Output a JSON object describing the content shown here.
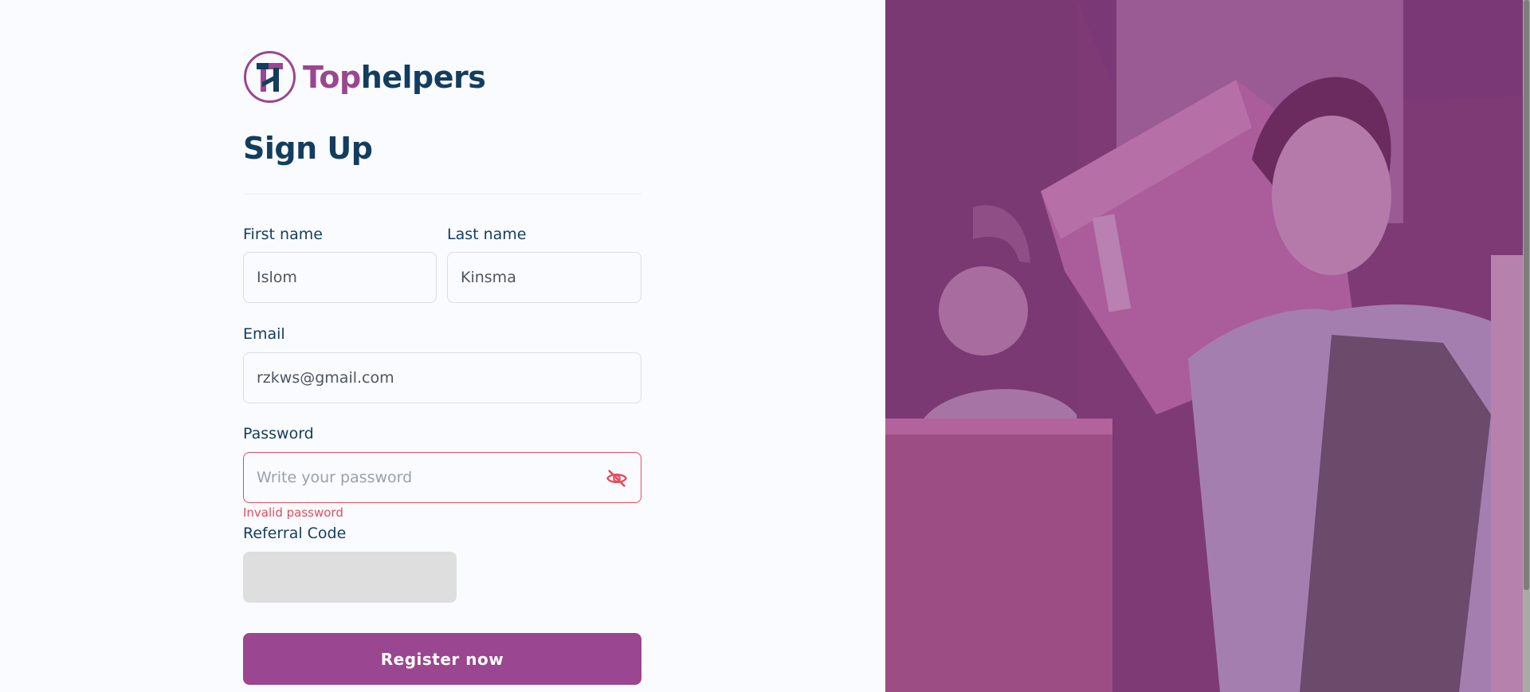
{
  "brand": {
    "name_part1": "Top",
    "name_part2": "helpers",
    "accent": "#9a4690",
    "dark": "#133d5f"
  },
  "page": {
    "title": "Sign Up"
  },
  "form": {
    "first_name": {
      "label": "First name",
      "value": "Islom"
    },
    "last_name": {
      "label": "Last name",
      "value": "Kinsma"
    },
    "email": {
      "label": "Email",
      "value": "rzkws@gmail.com"
    },
    "password": {
      "label": "Password",
      "value": "",
      "placeholder": "Write your password",
      "error": "Invalid password",
      "toggle_icon": "eye-slash-icon"
    },
    "referral": {
      "label": "Referral Code",
      "value": ""
    },
    "submit_label": "Register now"
  },
  "colors": {
    "error": "#e64c5b",
    "button": "#9a4690",
    "overlay": "#9a4690"
  },
  "hero": {
    "overlay_color": "#9a4690",
    "image_subject": "two movers carrying cardboard boxes"
  }
}
